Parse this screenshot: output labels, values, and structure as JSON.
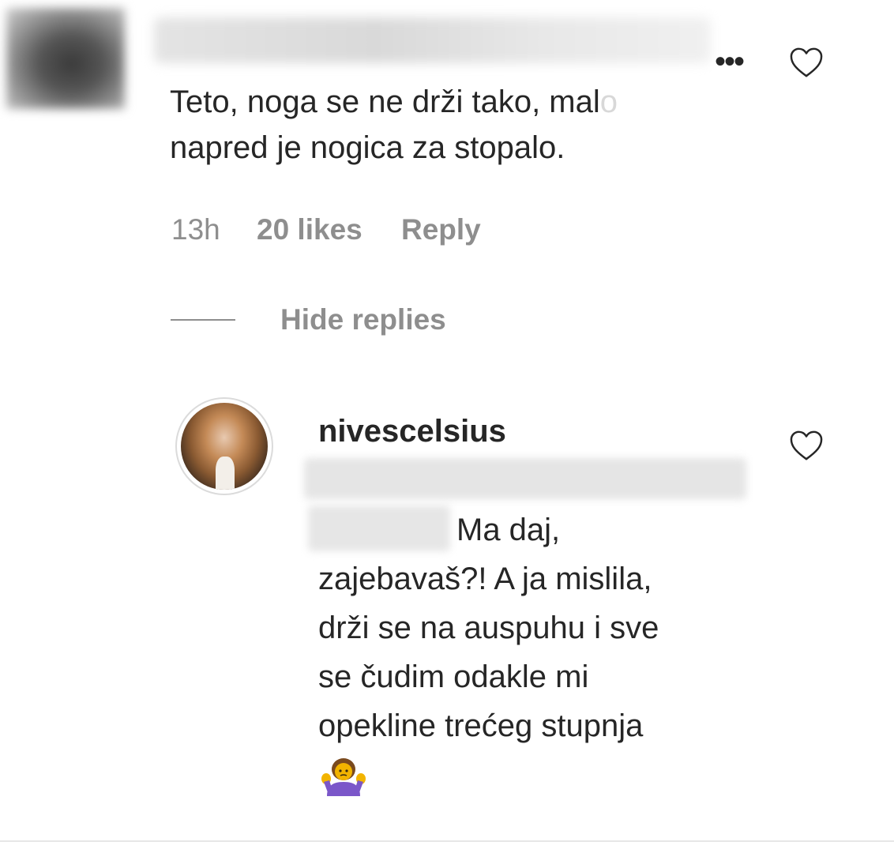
{
  "top_comment": {
    "text_before_fade": "Teto, noga se ne drži tako, mal",
    "text_fade": "o",
    "text_line2": "napred je nogica za stopalo.",
    "time": "13h",
    "likes": "20 likes",
    "reply_label": "Reply",
    "more_icon": "more-horizontal-icon",
    "like_icon": "heart-icon"
  },
  "thread": {
    "hide_replies_label": "Hide replies"
  },
  "reply": {
    "username": "nivescelsius",
    "line1": "Ma daj,",
    "line2": "zajebavaš?! A ja mislila,",
    "line3": "drži se na auspuhu i sve",
    "line4": "se čudim odakle mi",
    "line5": "opekline trećeg stupnja",
    "emoji_icon": "person-shrugging-icon",
    "like_icon": "heart-icon"
  },
  "colors": {
    "text": "#262626",
    "secondary": "#8e8e8e",
    "emoji_purple": "#7b57c9",
    "emoji_skin": "#f2b400"
  }
}
